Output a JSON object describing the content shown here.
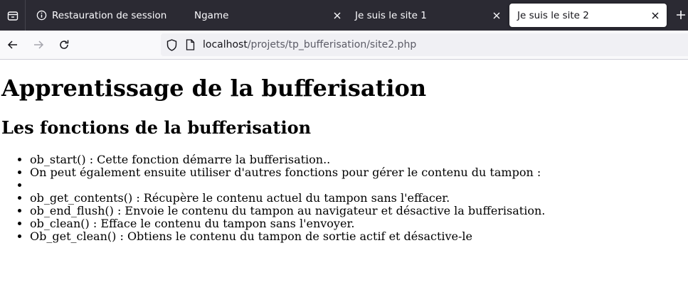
{
  "browser": {
    "tabs": [
      {
        "title": "Restauration de session",
        "active": false,
        "icon": "info-icon"
      },
      {
        "title": "Ngame",
        "active": false
      },
      {
        "title": "Je suis le site 1",
        "active": false
      },
      {
        "title": "Je suis le site 2",
        "active": true
      }
    ],
    "url": {
      "host": "localhost",
      "path": "/projets/tp_bufferisation/site2.php"
    },
    "colors": {
      "tabbar_bg": "#2b2a33",
      "navbar_bg": "#f9f9fb",
      "urlbar_bg": "#f0f0f4"
    }
  },
  "page": {
    "title": "Apprentissage de la bufferisation",
    "subtitle": "Les fonctions de la bufferisation",
    "items": [
      "ob_start() : Cette fonction démarre la bufferisation..",
      "On peut également ensuite utiliser d'autres fonctions pour gérer le contenu du tampon :",
      "",
      "ob_get_contents() : Récupère le contenu actuel du tampon sans l'effacer.",
      "ob_end_flush() : Envoie le contenu du tampon au navigateur et désactive la bufferisation.",
      "ob_clean() : Efface le contenu du tampon sans l'envoyer.",
      "Ob_get_clean() : Obtiens le contenu du tampon de sortie actif et désactive-le"
    ]
  }
}
